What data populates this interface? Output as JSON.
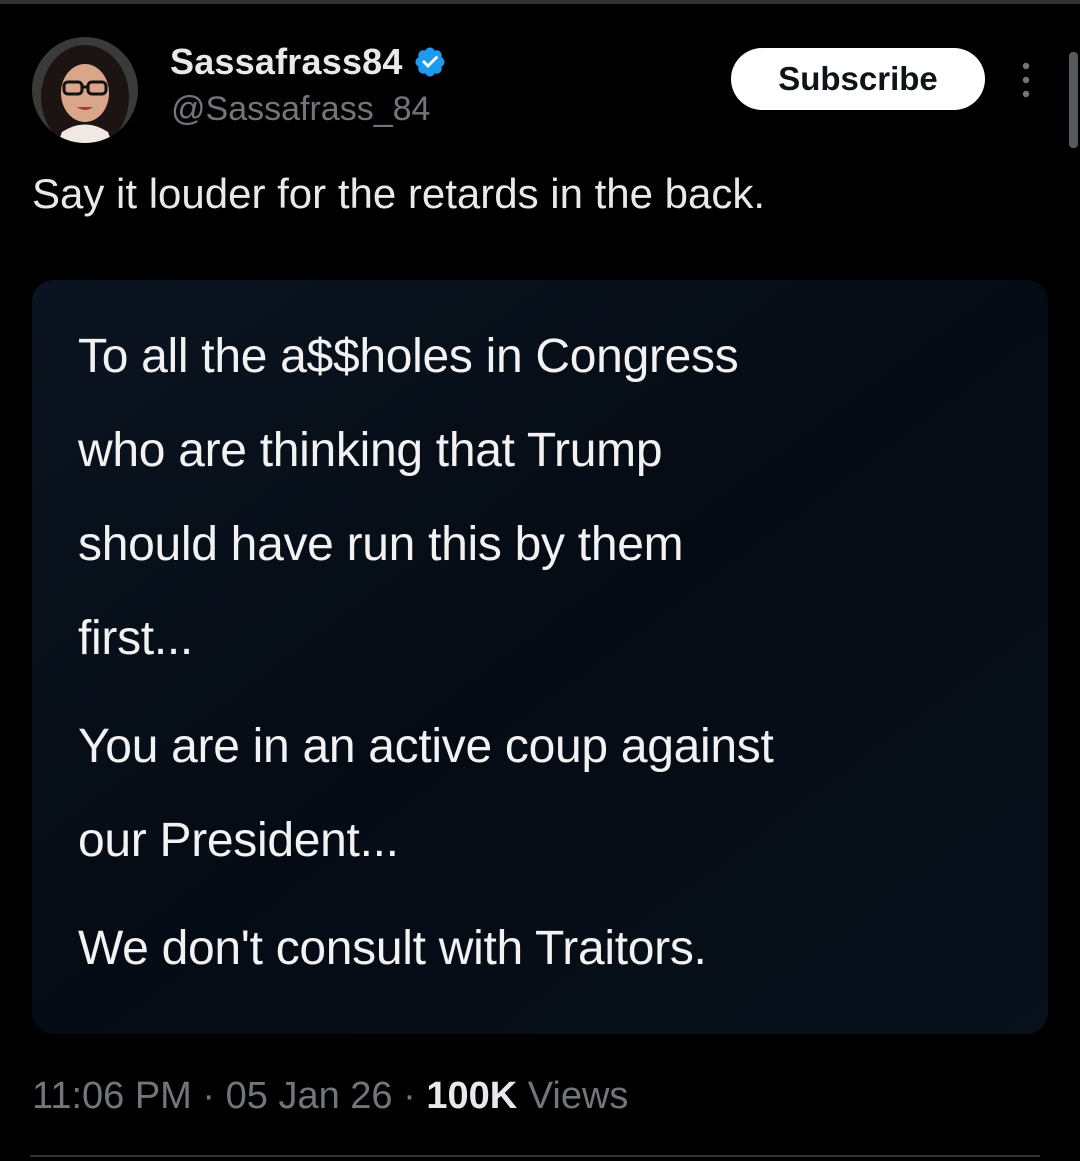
{
  "author": {
    "display_name": "Sassafrass84",
    "handle": "@Sassafrass_84",
    "verified": true,
    "verified_color": "#1d9bf0"
  },
  "header": {
    "subscribe_label": "Subscribe",
    "more_icon": "more-vertical-icon"
  },
  "tweet": {
    "text": "Say it louder for the retards in the back."
  },
  "media": {
    "line1": "To all the a$$holes in Congress\nwho are thinking that Trump\nshould have run this by them\nfirst...",
    "line2": "You are in an active coup against\nour President...",
    "line3": "We don't consult with Traitors."
  },
  "meta": {
    "time": "11:06 PM",
    "separator": " · ",
    "date": "05 Jan 26",
    "views_count": "100K",
    "views_label": " Views"
  },
  "colors": {
    "background": "#000000",
    "text_primary": "#e7e9ea",
    "text_secondary": "#71767b",
    "media_background": "#050c15"
  }
}
